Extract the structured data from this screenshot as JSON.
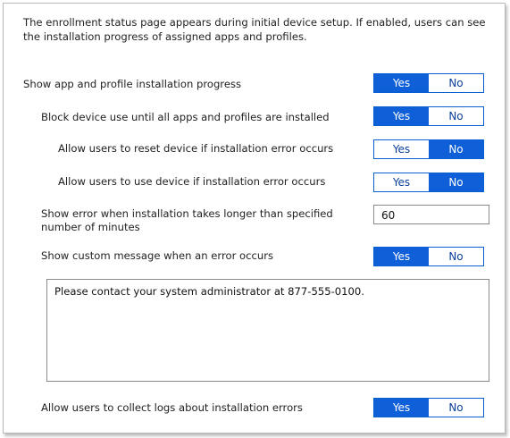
{
  "intro_text": "The enrollment status page appears during initial device setup. If enabled, users can see the installation progress of assigned apps and profiles.",
  "settings": [
    {
      "label": "Show app and profile installation progress",
      "yes": "Yes",
      "no": "No",
      "selected": "Yes"
    },
    {
      "label": "Block device use until all apps and profiles are installed",
      "yes": "Yes",
      "no": "No",
      "selected": "Yes"
    },
    {
      "label": "Allow users to reset device if installation error occurs",
      "yes": "Yes",
      "no": "No",
      "selected": "No"
    },
    {
      "label": "Allow users to use device if installation error occurs",
      "yes": "Yes",
      "no": "No",
      "selected": "No"
    },
    {
      "label": "Show custom message when an error occurs",
      "yes": "Yes",
      "no": "No",
      "selected": "Yes"
    },
    {
      "label": "Allow users to collect logs about installation errors",
      "yes": "Yes",
      "no": "No",
      "selected": "Yes"
    }
  ],
  "timeout": {
    "label": "Show error when installation takes longer than specified number of minutes",
    "value": "60"
  },
  "custom_message": "Please contact your system administrator at 877-555-0100.",
  "colors": {
    "accent": "#0f5fd8",
    "border": "#b8b8b8"
  }
}
